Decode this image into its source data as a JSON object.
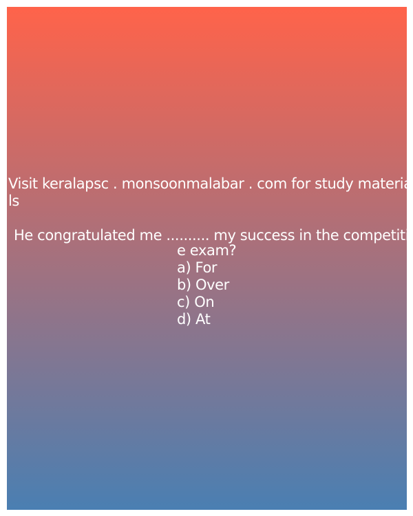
{
  "visit_line_1": "Visit keralapsc . monsoonmalabar . com for study materia",
  "visit_line_2": "ls",
  "question_line_1": "He congratulated me .......... my success in the competitiv",
  "question_line_2": "e exam?",
  "options": [
    "a) For",
    "b) Over",
    "c) On",
    "d) At"
  ],
  "colors": {
    "gradient_top": "#ff634a",
    "gradient_bottom": "#4a7fb2",
    "text": "#ffffff"
  }
}
